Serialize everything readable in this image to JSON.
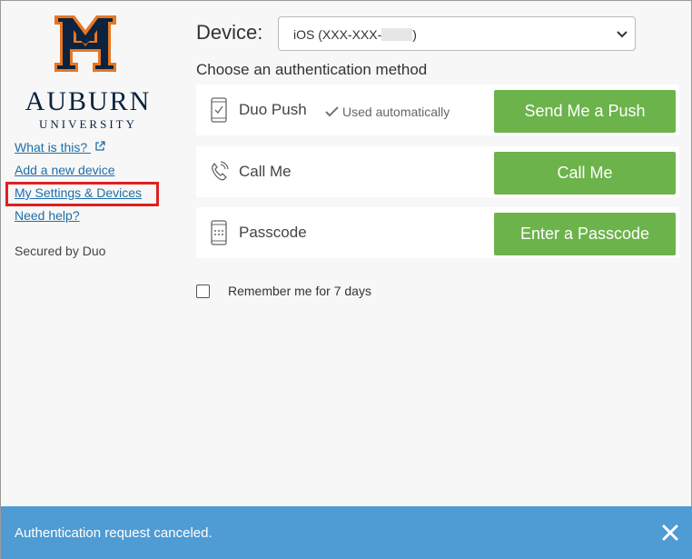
{
  "brand": {
    "name": "AUBURN",
    "sub": "UNIVERSITY",
    "logo_colors": {
      "navy": "#0c2340",
      "orange": "#e87722"
    },
    "logo_icon": "auburn-au-logo"
  },
  "sidebar": {
    "links": [
      {
        "label": "What is this?",
        "icon": "external-link-icon"
      },
      {
        "label": "Add a new device"
      },
      {
        "label": "My Settings & Devices",
        "highlighted": true
      },
      {
        "label": "Need help?"
      }
    ],
    "secured_text": "Secured by Duo",
    "highlight_color": "#e02020"
  },
  "device": {
    "label": "Device:",
    "selected_value": "iOS (XXX-XXX-",
    "selected_suffix": ")"
  },
  "auth": {
    "heading": "Choose an authentication method",
    "methods": [
      {
        "icon": "phone-check-icon",
        "label": "Duo Push",
        "note": "Used automatically",
        "button": "Send Me a Push"
      },
      {
        "icon": "phone-call-icon",
        "label": "Call Me",
        "button": "Call Me"
      },
      {
        "icon": "keypad-phone-icon",
        "label": "Passcode",
        "button": "Enter a Passcode"
      }
    ],
    "button_color": "#6bb34a"
  },
  "remember": {
    "label": "Remember me for 7 days",
    "checked": false
  },
  "status": {
    "message": "Authentication request canceled.",
    "color": "#4f9bd3",
    "close_icon": "close-icon"
  }
}
